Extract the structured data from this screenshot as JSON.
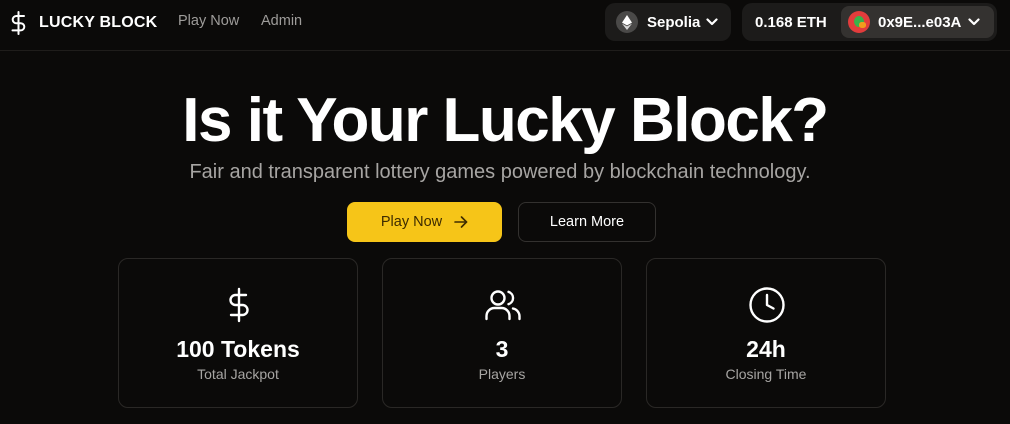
{
  "header": {
    "brand_name": "LUCKY BLOCK",
    "nav": [
      {
        "label": "Play Now"
      },
      {
        "label": "Admin"
      }
    ],
    "network": {
      "name": "Sepolia",
      "icon": "ethereum-icon"
    },
    "account": {
      "balance": "0.168 ETH",
      "address": "0x9E...e03A"
    }
  },
  "hero": {
    "title": "Is it Your Lucky Block?",
    "subtitle": "Fair and transparent lottery games powered by blockchain technology.",
    "primary_button": "Play Now",
    "secondary_button": "Learn More"
  },
  "stats": [
    {
      "icon": "dollar-icon",
      "value": "100 Tokens",
      "label": "Total Jackpot"
    },
    {
      "icon": "users-icon",
      "value": "3",
      "label": "Players"
    },
    {
      "icon": "clock-icon",
      "value": "24h",
      "label": "Closing Time"
    }
  ],
  "colors": {
    "background": "#0b0a09",
    "accent": "#f6c518",
    "muted_text": "#a7a5a3",
    "card_border": "#2a2826"
  }
}
